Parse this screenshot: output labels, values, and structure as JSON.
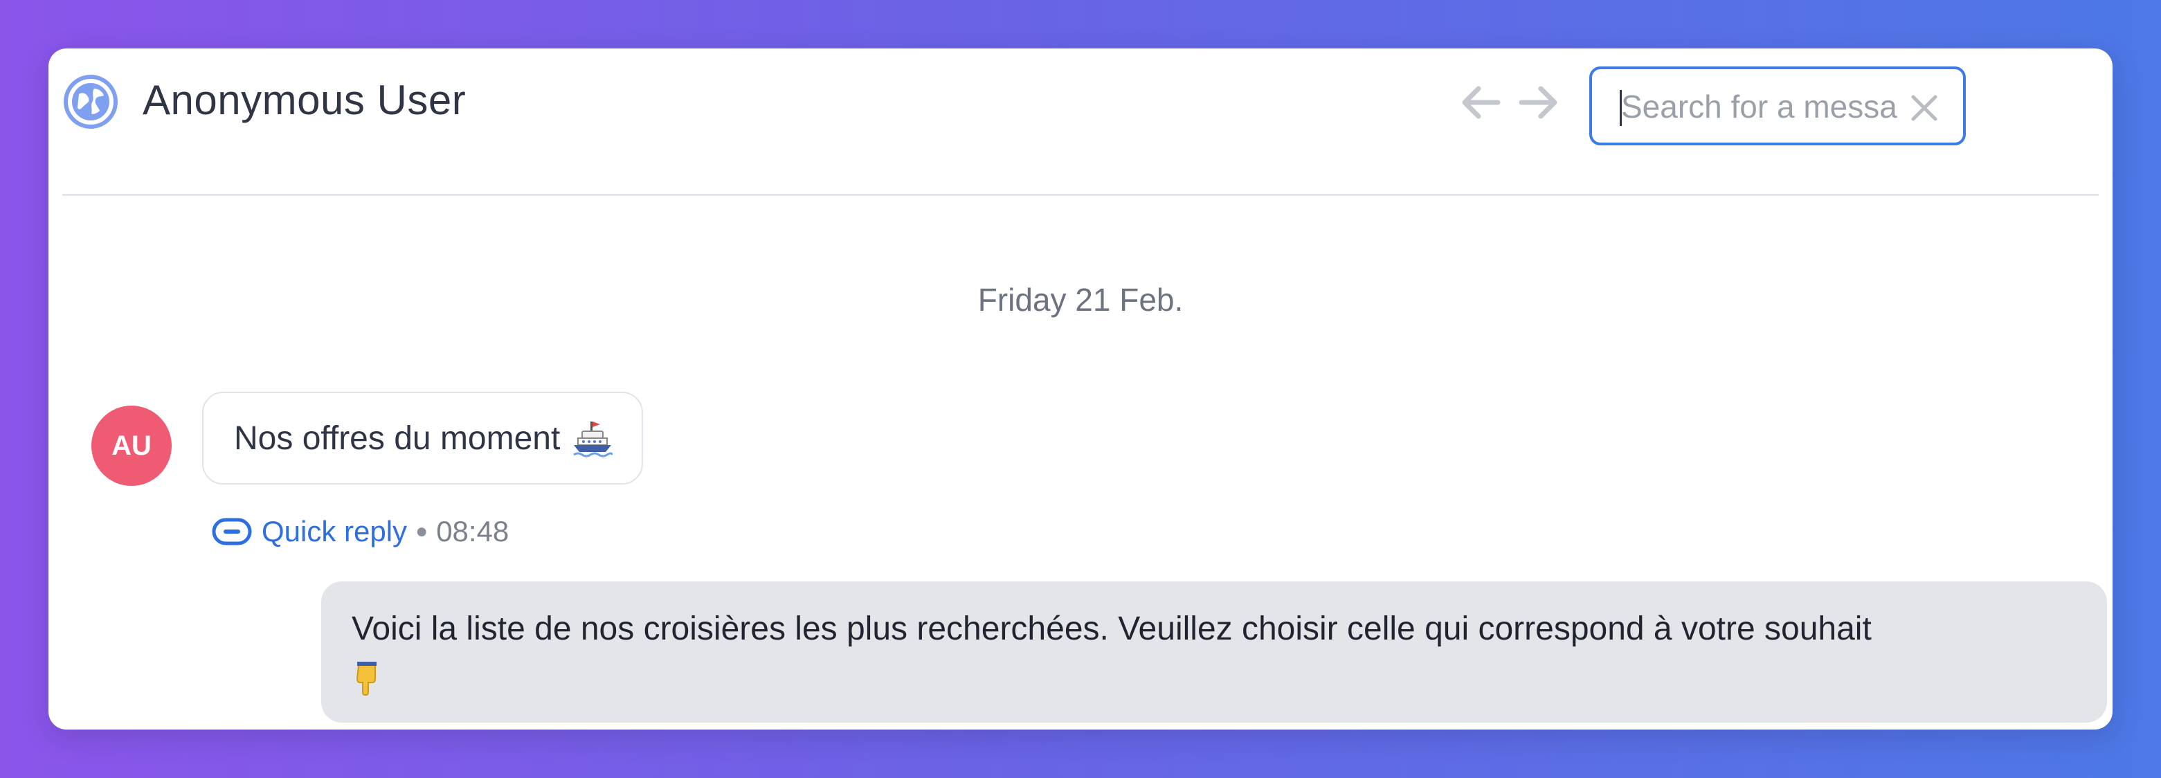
{
  "header": {
    "title": "Anonymous User",
    "search_placeholder": "Search for a message"
  },
  "conversation": {
    "date_separator": "Friday 21 Feb.",
    "avatar_initials": "AU",
    "incoming_message": "Nos offres du moment",
    "incoming_emoji_icon": "ship-icon",
    "meta_label": "Quick reply",
    "meta_time": "08:48",
    "outgoing_message": "Voici la liste de nos croisières les plus recherchées. Veuillez choisir celle qui correspond à votre souhait",
    "outgoing_emoji_icon": "pointing-down-icon"
  },
  "colors": {
    "accent": "#3d7be6",
    "avatar": "#ef5b73",
    "link": "#2d6fe0",
    "outgoing_bubble": "#e4e5e9"
  }
}
